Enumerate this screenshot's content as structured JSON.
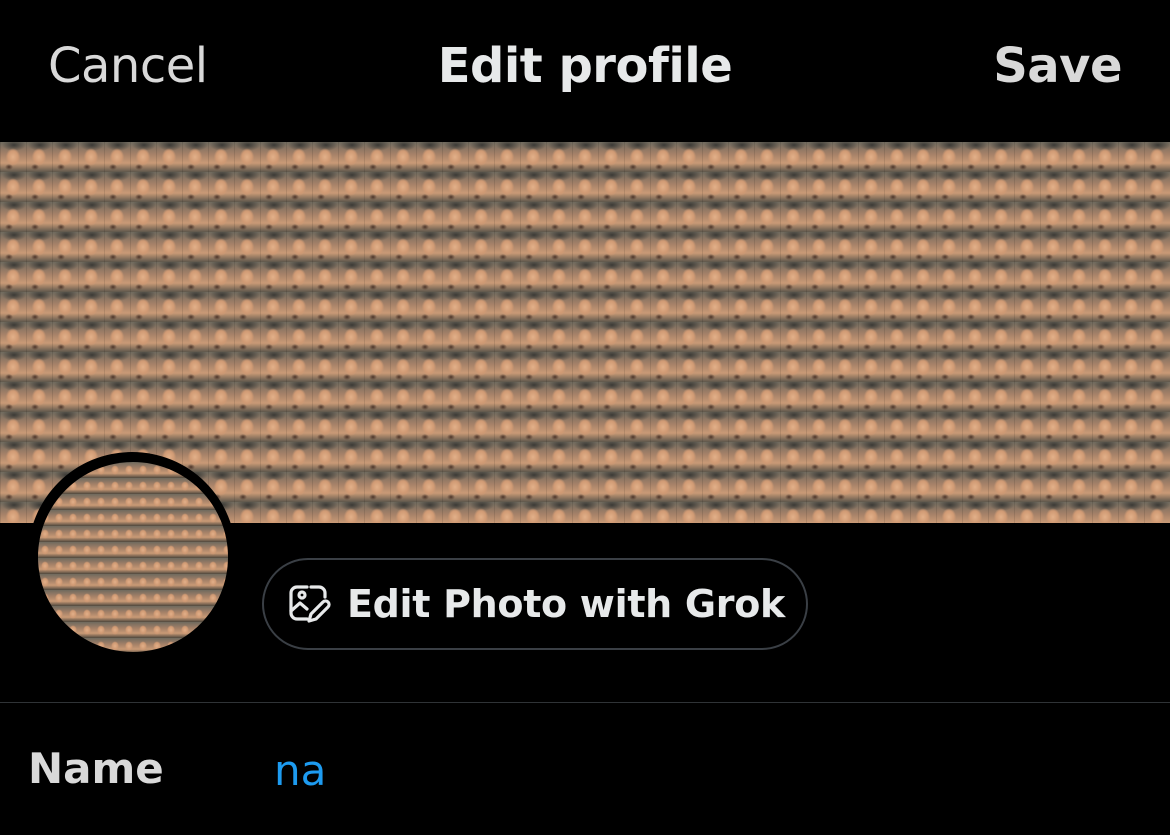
{
  "header": {
    "cancel_label": "Cancel",
    "title": "Edit profile",
    "save_label": "Save"
  },
  "profile": {
    "edit_photo_label": "Edit Photo with Grok",
    "edit_photo_icon": "image-edit-icon",
    "name_label": "Name",
    "name_value": "na"
  },
  "colors": {
    "background": "#000000",
    "text_primary": "#e7e9ea",
    "text_secondary": "#d9d9d9",
    "accent": "#1d9bf0",
    "border": "#2f3336"
  }
}
